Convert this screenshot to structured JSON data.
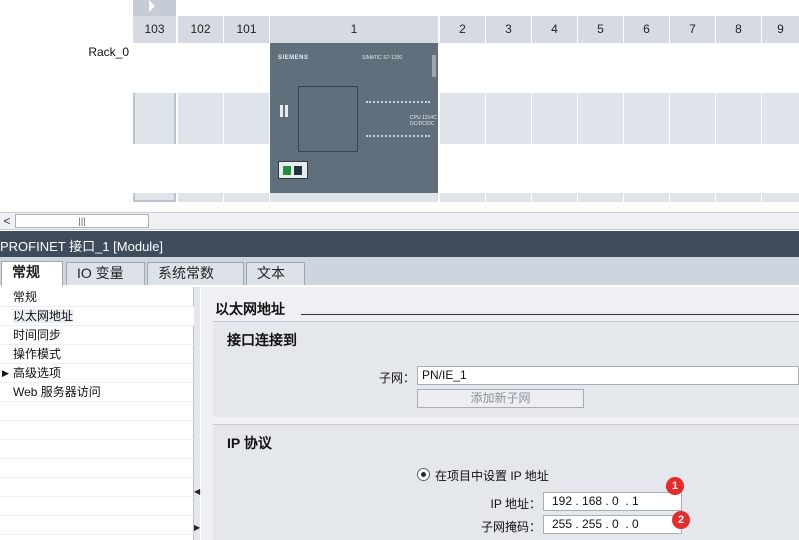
{
  "rack": {
    "label": "Rack_0",
    "slots": [
      "103",
      "102",
      "101",
      "1",
      "2",
      "3",
      "4",
      "5",
      "6",
      "7",
      "8",
      "9"
    ],
    "cpu": {
      "brand": "SIEMENS",
      "model": "SIMATIC S7-1200",
      "line1": "CPU 1214C",
      "line2": "DC/DC/DC"
    }
  },
  "scrollbar": {
    "left_arrow": "<",
    "thumb_grip": "|||"
  },
  "inspector": {
    "title": "PROFINET 接口_1 [Module]",
    "tabs": [
      "常规",
      "IO 变量",
      "系统常数",
      "文本"
    ],
    "nav": [
      {
        "label": "常规",
        "expandable": false
      },
      {
        "label": "以太网地址",
        "expandable": false,
        "selected": true
      },
      {
        "label": "时间同步",
        "expandable": false
      },
      {
        "label": "操作模式",
        "expandable": false
      },
      {
        "label": "高级选项",
        "expandable": true
      },
      {
        "label": "Web 服务器访问",
        "expandable": false
      }
    ],
    "section_title": "以太网地址",
    "interface_group": {
      "title": "接口连接到",
      "subnet_label": "子网：",
      "subnet_value": "PN/IE_1",
      "add_subnet_button": "添加新子网"
    },
    "ip_group": {
      "title": "IP 协议",
      "radio_label": "在项目中设置 IP 地址",
      "ip_label": "IP 地址：",
      "ip_value": "192 . 168 . 0  . 1",
      "mask_label": "子网掩码：",
      "mask_value": "255 . 255 . 0  . 0",
      "badge_1": "1",
      "badge_2": "2"
    }
  },
  "colors": {
    "title_bar": "#3d4b5a",
    "badge": "#e52b2b",
    "cpu_module": "#5f6f7b"
  }
}
